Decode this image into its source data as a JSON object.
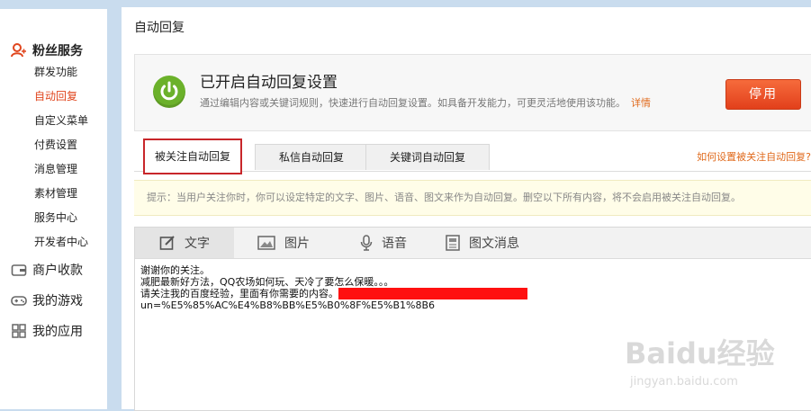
{
  "sidebar": {
    "section_title": "粉丝服务",
    "items": [
      {
        "label": "群发功能"
      },
      {
        "label": "自动回复",
        "active": true
      },
      {
        "label": "自定义菜单"
      },
      {
        "label": "付费设置"
      },
      {
        "label": "消息管理"
      },
      {
        "label": "素材管理"
      },
      {
        "label": "服务中心"
      },
      {
        "label": "开发者中心"
      }
    ],
    "groups": [
      {
        "label": "商户收款",
        "icon": "wallet-icon"
      },
      {
        "label": "我的游戏",
        "icon": "gamepad-icon"
      },
      {
        "label": "我的应用",
        "icon": "apps-grid-icon"
      }
    ]
  },
  "page": {
    "title": "自动回复"
  },
  "status": {
    "title": "已开启自动回复设置",
    "description": "通过编辑内容或关键词规则，快速进行自动回复设置。如具备开发能力，可更灵活地使用该功能。",
    "detail_link": "详情",
    "stop_button": "停用"
  },
  "tabs": [
    {
      "label": "被关注自动回复",
      "active": true
    },
    {
      "label": "私信自动回复"
    },
    {
      "label": "关键词自动回复"
    }
  ],
  "help_link": "如何设置被关注自动回复?",
  "tip": "提示：当用户关注你时，你可以设定特定的文字、图片、语音、图文来作为自动回复。删空以下所有内容，将不会启用被关注自动回复。",
  "editor": {
    "tabs": [
      {
        "label": "文字",
        "icon": "edit-icon",
        "active": true
      },
      {
        "label": "图片",
        "icon": "image-icon"
      },
      {
        "label": "语音",
        "icon": "microphone-icon"
      },
      {
        "label": "图文消息",
        "icon": "article-icon"
      }
    ],
    "lines": [
      "谢谢你的关注。",
      "减肥最新好方法，QQ农场如何玩、天冷了要怎么保暖。。。",
      "请关注我的百度经验，里面有你需要的内容。",
      "un=%E5%85%AC%E4%B8%BB%E5%B0%8F%E5%B1%8B6"
    ]
  },
  "watermark": {
    "brand": "Baidu经验",
    "url": "jingyan.baidu.com"
  },
  "colors": {
    "accent": "#e0461e",
    "power": "#6bb12a",
    "stop": "#e2401b",
    "active_tab_border": "#c8262a"
  }
}
